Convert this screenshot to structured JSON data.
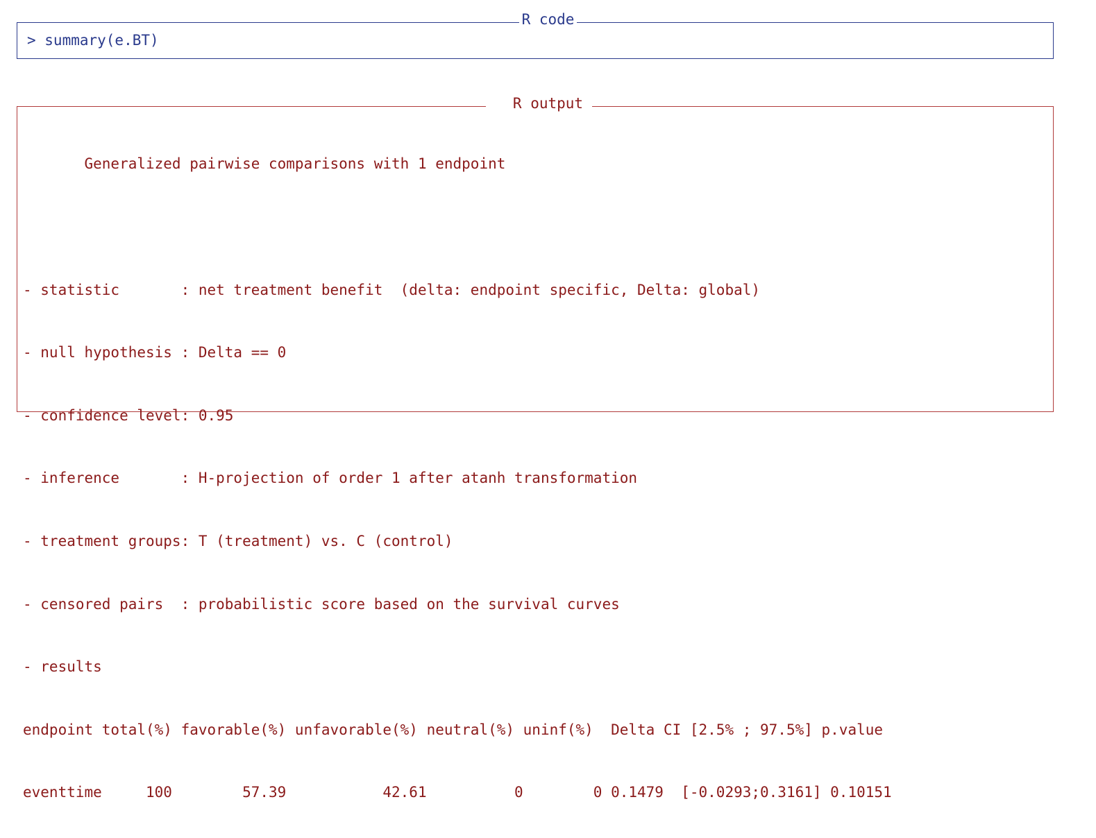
{
  "code_block": {
    "header": "R code",
    "command": "> summary(e.BT)"
  },
  "output_block": {
    "header": "R output",
    "lines": [
      "       Generalized pairwise comparisons with 1 endpoint",
      "",
      "- statistic       : net treatment benefit  (delta: endpoint specific, Delta: global)",
      "- null hypothesis : Delta == 0",
      "- confidence level: 0.95",
      "- inference       : H-projection of order 1 after atanh transformation",
      "- treatment groups: T (treatment) vs. C (control)",
      "- censored pairs  : probabilistic score based on the survival curves",
      "- results",
      "endpoint total(%) favorable(%) unfavorable(%) neutral(%) uninf(%)  Delta CI [2.5% ; 97.5%] p.value",
      "eventtime     100        57.39           42.61          0        0 0.1479  [-0.0293;0.3161] 0.10151"
    ]
  },
  "colors": {
    "code": "#2a3a8c",
    "output": "#8b1a1a",
    "output_border": "#b03a3a"
  }
}
